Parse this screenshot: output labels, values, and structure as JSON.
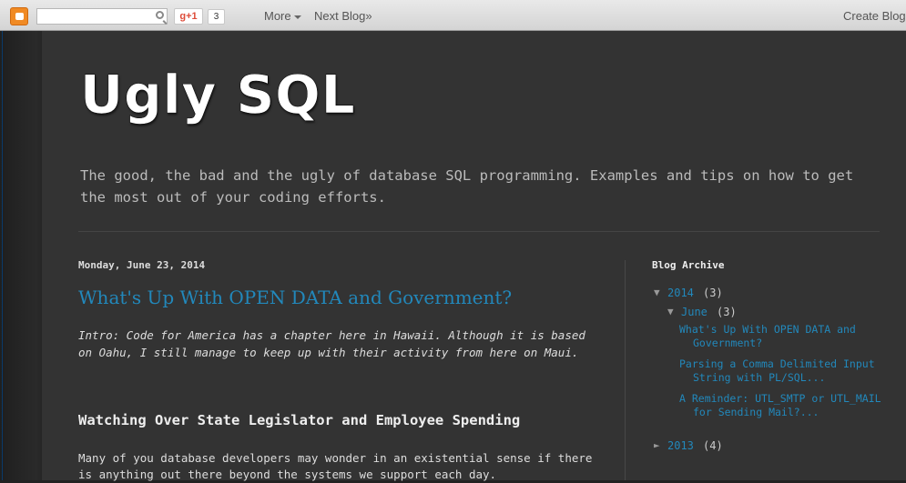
{
  "navbar": {
    "search_placeholder": "",
    "gplus_label": "g+1",
    "gplus_count": "3",
    "more_label": "More",
    "next_blog_label": "Next Blog»",
    "create_blog_label": "Create Blog"
  },
  "header": {
    "title": "Ugly SQL",
    "description": "The good, the bad and the ugly of database SQL programming. Examples and tips on how to get the most out of your coding efforts."
  },
  "post": {
    "date": "Monday, June 23, 2014",
    "title": "What's Up With OPEN DATA and Government?",
    "intro": "Intro:  Code for America has a chapter here in Hawaii.  Although it is based on Oahu, I still manage to keep up with their activity from here on Maui.",
    "heading": "Watching Over State Legislator and Employee Spending",
    "body": "Many of you database developers may wonder in an existential sense if there is anything out there beyond the systems we support each day."
  },
  "sidebar": {
    "title": "Blog Archive",
    "years": [
      {
        "toggle": "▼",
        "label": "2014",
        "count": "(3)"
      },
      {
        "toggle": "►",
        "label": "2013",
        "count": "(4)"
      }
    ],
    "month": {
      "toggle": "▼",
      "label": "June",
      "count": "(3)"
    },
    "posts": [
      "What's Up With OPEN DATA and Government?",
      "Parsing a Comma Delimited Input String with PL/SQL...",
      "A Reminder: UTL_SMTP or UTL_MAIL for Sending Mail?..."
    ]
  },
  "colors": {
    "background": "#333333",
    "link": "#2288bb",
    "text": "#dddddd"
  }
}
